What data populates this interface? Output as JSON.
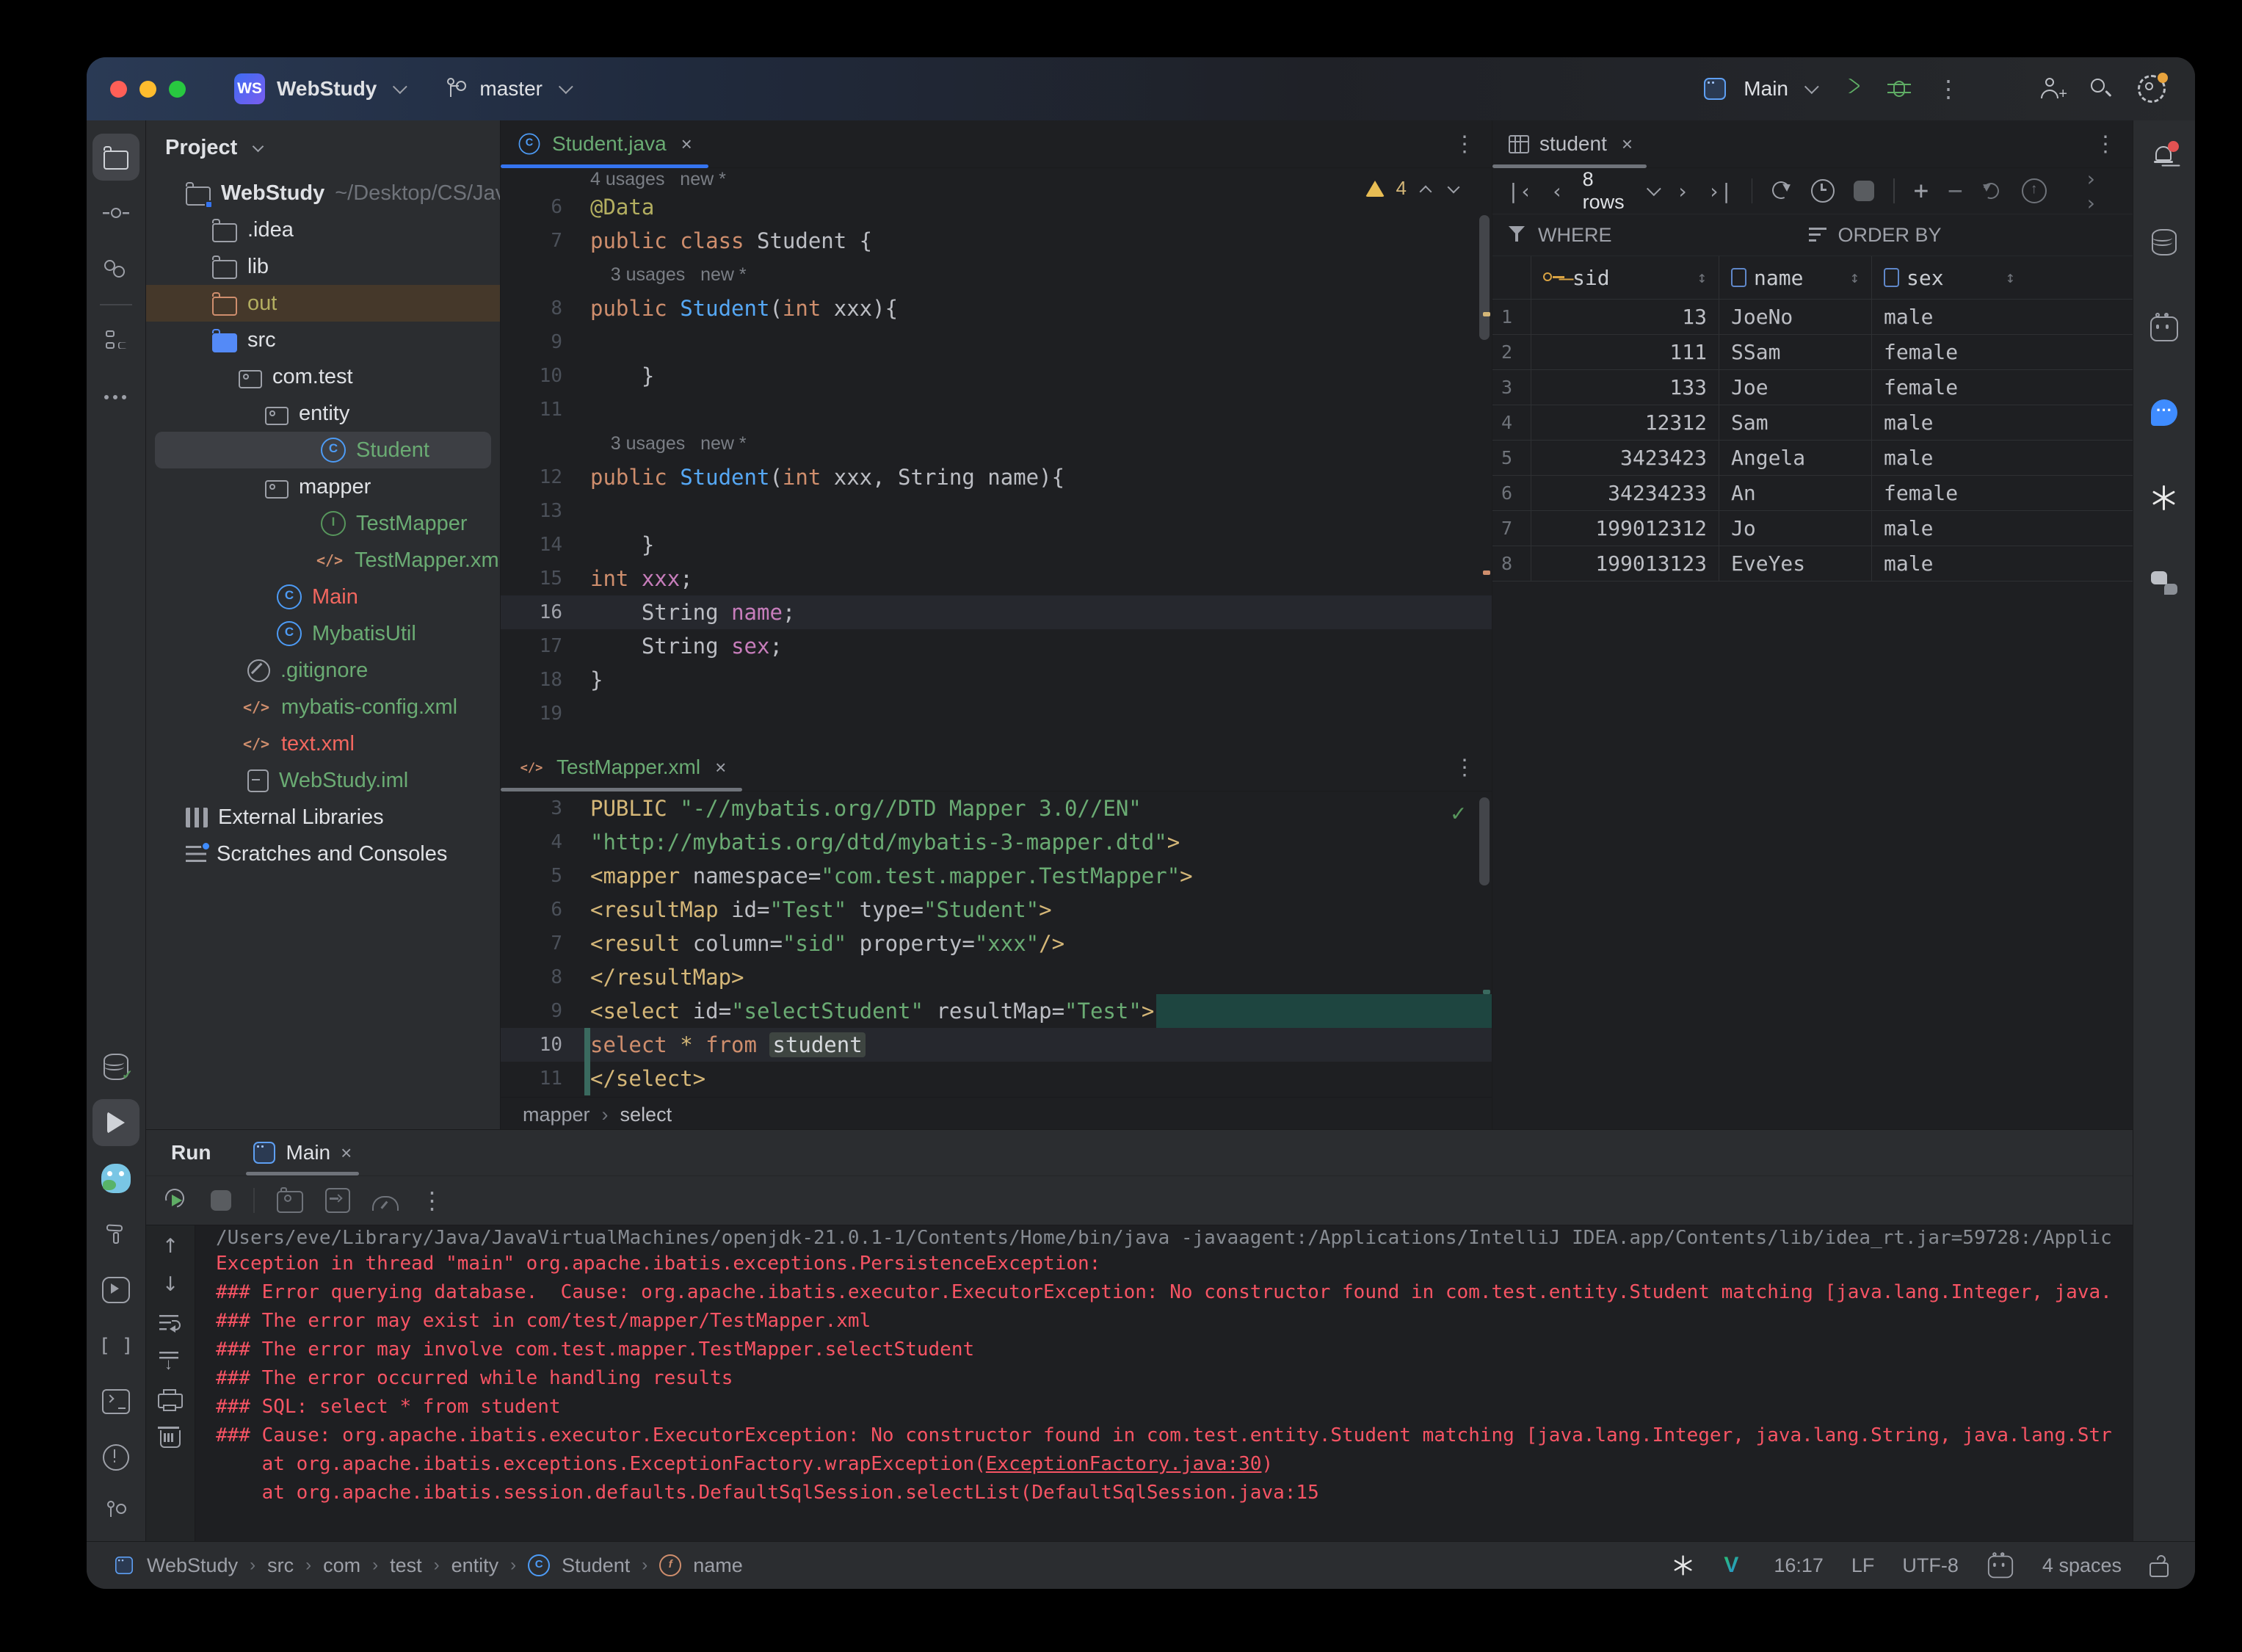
{
  "titlebar": {
    "project_badge": "WS",
    "project": "WebStudy",
    "branch": "master",
    "run_config": "Main",
    "icons": [
      "git-branch",
      "run",
      "debug",
      "more",
      "add-user",
      "search",
      "settings"
    ]
  },
  "left_strip_icons": [
    "project-folder",
    "commit",
    "pull-requests",
    "structure",
    "more",
    "database-check",
    "run",
    "go-plugin",
    "build",
    "coverage",
    "bookmarks",
    "terminal",
    "problems",
    "git"
  ],
  "right_strip_icons": [
    "notifications",
    "database",
    "ai-assistant",
    "chat",
    "openai",
    "collaboration"
  ],
  "project": {
    "header": "Project",
    "tree": [
      {
        "label": "WebStudy",
        "suffix": "~/Desktop/CS/Jav",
        "icon": "ic-folder-project",
        "chevcls": "chev-d",
        "cls": "t-bold",
        "style": "padding-left:24px"
      },
      {
        "label": ".idea",
        "icon": "ic-folder",
        "chevcls": "chev-r",
        "style": "padding-left:60px"
      },
      {
        "label": "lib",
        "icon": "ic-folder",
        "chevcls": "chev-r",
        "style": "padding-left:60px"
      },
      {
        "label": "out",
        "icon": "ic-folder-orange",
        "chevcls": "chev-r",
        "cls": "t-olive",
        "row": "row-out",
        "style": "padding-left:60px"
      },
      {
        "label": "src",
        "icon": "ic-folder-blue",
        "chevcls": "chev-d",
        "style": "padding-left:60px"
      },
      {
        "label": "com.test",
        "icon": "ic-pkg",
        "chevcls": "chev-d",
        "style": "padding-left:96px"
      },
      {
        "label": "entity",
        "icon": "ic-pkg",
        "chevcls": "chev-d",
        "style": "padding-left:132px"
      },
      {
        "label": "Student",
        "icon": "ic-class",
        "cls": "t-green",
        "row": "row-sel",
        "style": "padding-left:196px"
      },
      {
        "label": "mapper",
        "icon": "ic-pkg",
        "chevcls": "chev-d",
        "style": "padding-left:132px"
      },
      {
        "label": "TestMapper",
        "icon": "ic-iface",
        "cls": "t-green",
        "style": "padding-left:208px"
      },
      {
        "label": "TestMapper.xml",
        "icon": "ic-xmlfile",
        "cls": "t-green",
        "style": "padding-left:200px"
      },
      {
        "label": "Main",
        "icon": "ic-class",
        "cls": "t-red",
        "style": "padding-left:148px"
      },
      {
        "label": "MybatisUtil",
        "icon": "ic-class",
        "cls": "t-green",
        "style": "padding-left:148px"
      },
      {
        "label": ".gitignore",
        "icon": "ic-ign",
        "cls": "t-green",
        "style": "padding-left:108px"
      },
      {
        "label": "mybatis-config.xml",
        "icon": "ic-xmlfile",
        "cls": "t-green",
        "style": "padding-left:100px"
      },
      {
        "label": "text.xml",
        "icon": "ic-xmlfile",
        "cls": "t-red",
        "style": "padding-left:100px"
      },
      {
        "label": "WebStudy.iml",
        "icon": "ic-iml",
        "cls": "t-green",
        "style": "padding-left:108px"
      },
      {
        "label": "External Libraries",
        "icon": "ic-lib",
        "chevcls": "chev-r",
        "style": "padding-left:24px"
      },
      {
        "label": "Scratches and Consoles",
        "icon": "ic-scratch",
        "chevcls": "chev-r",
        "style": "padding-left:24px"
      }
    ]
  },
  "editors": {
    "java": {
      "tab": "Student.java",
      "warning_count": "4",
      "lines": [
        {
          "num": "",
          "seg": [
            [
              "g",
              "4 usages   new *"
            ]
          ],
          "style": "height:30px;overflow:hidden;align-items:flex-end"
        },
        {
          "num": "6",
          "seg": [
            [
              "a",
              "@Data"
            ]
          ]
        },
        {
          "num": "7",
          "seg": [
            [
              "k",
              "public class "
            ],
            [
              "p",
              "Student {"
            ]
          ]
        },
        {
          "num": "",
          "seg": [
            [
              "g",
              "    3 usages   new *"
            ]
          ]
        },
        {
          "num": "8",
          "seg": [
            [
              "p",
              "    "
            ],
            [
              "k",
              "public "
            ],
            [
              "c",
              "Student"
            ],
            [
              "p",
              "("
            ],
            [
              "k",
              "int"
            ],
            [
              "p",
              " xxx){"
            ]
          ]
        },
        {
          "num": "9",
          "seg": []
        },
        {
          "num": "10",
          "seg": [
            [
              "p",
              "    }"
            ]
          ]
        },
        {
          "num": "11",
          "seg": []
        },
        {
          "num": "",
          "seg": [
            [
              "g",
              "    3 usages   new *"
            ]
          ]
        },
        {
          "num": "12",
          "seg": [
            [
              "p",
              "    "
            ],
            [
              "k",
              "public "
            ],
            [
              "c",
              "Student"
            ],
            [
              "p",
              "("
            ],
            [
              "k",
              "int"
            ],
            [
              "p",
              " xxx, String name){"
            ]
          ]
        },
        {
          "num": "13",
          "seg": []
        },
        {
          "num": "14",
          "seg": [
            [
              "p",
              "    }"
            ]
          ]
        },
        {
          "num": "15",
          "seg": [
            [
              "p",
              "    "
            ],
            [
              "k",
              "int "
            ],
            [
              "f",
              "xxx"
            ],
            [
              "p",
              ";"
            ]
          ]
        },
        {
          "num": "16",
          "numcls": "on",
          "row": "cur",
          "seg": [
            [
              "p",
              "    String "
            ],
            [
              "f",
              "name"
            ],
            [
              "p",
              ";"
            ]
          ]
        },
        {
          "num": "17",
          "seg": [
            [
              "p",
              "    String "
            ],
            [
              "f",
              "sex"
            ],
            [
              "p",
              ";"
            ]
          ]
        },
        {
          "num": "18",
          "seg": [
            [
              "p",
              "}"
            ]
          ]
        },
        {
          "num": "19",
          "seg": []
        }
      ]
    },
    "xml": {
      "tab": "TestMapper.xml",
      "lines": [
        {
          "num": "3",
          "seg": [
            [
              "p",
              "        "
            ],
            [
              "y",
              "PUBLIC "
            ],
            [
              "s",
              "\"-//mybatis.org//DTD Mapper 3.0//EN\""
            ]
          ]
        },
        {
          "num": "4",
          "seg": [
            [
              "p",
              "        "
            ],
            [
              "s",
              "\"http://mybatis.org/dtd/mybatis-3-mapper.dtd\""
            ],
            [
              "y",
              ">"
            ]
          ]
        },
        {
          "num": "5",
          "seg": [
            [
              "y",
              "<mapper "
            ],
            [
              "p",
              "namespace="
            ],
            [
              "s",
              "\"com.test.mapper.TestMapper\""
            ],
            [
              "y",
              ">"
            ]
          ]
        },
        {
          "num": "6",
          "seg": [
            [
              "p",
              "    "
            ],
            [
              "y",
              "<resultMap "
            ],
            [
              "p",
              "id="
            ],
            [
              "s",
              "\"Test\""
            ],
            [
              "p",
              " type="
            ],
            [
              "s",
              "\"Student\""
            ],
            [
              "y",
              ">"
            ]
          ]
        },
        {
          "num": "7",
          "seg": [
            [
              "p",
              "        "
            ],
            [
              "y",
              "<result "
            ],
            [
              "p",
              "column="
            ],
            [
              "s",
              "\"sid\""
            ],
            [
              "p",
              " property="
            ],
            [
              "s",
              "\"xxx\""
            ],
            [
              "y",
              "/>"
            ]
          ]
        },
        {
          "num": "8",
          "seg": [
            [
              "p",
              "    "
            ],
            [
              "y",
              "</resultMap>"
            ]
          ]
        },
        {
          "num": "9",
          "seg": [
            [
              "p",
              "    "
            ],
            [
              "y",
              "<select "
            ],
            [
              "p",
              "id="
            ],
            [
              "s",
              "\"selectStudent\""
            ],
            [
              "p",
              " resultMap="
            ],
            [
              "s",
              "\"Test\""
            ],
            [
              "y",
              ">"
            ],
            [
              "fill",
              ""
            ]
          ]
        },
        {
          "num": "10",
          "numcls": "on",
          "row": "cur",
          "gut": "inj",
          "seg": [
            [
              "p",
              "        "
            ],
            [
              "k",
              "select "
            ],
            [
              "y",
              "* "
            ],
            [
              "k",
              "from "
            ],
            [
              "hl",
              "student"
            ]
          ]
        },
        {
          "num": "11",
          "gut": "inj",
          "seg": [
            [
              "p",
              "    "
            ],
            [
              "y",
              "</select>"
            ]
          ]
        }
      ]
    },
    "breadcrumb": [
      "mapper",
      "select"
    ]
  },
  "db": {
    "tab": "student",
    "rows_label": "8 rows",
    "where_label": "WHERE",
    "order_label": "ORDER BY",
    "cols": [
      {
        "label": "sid",
        "icon": "key"
      },
      {
        "label": "name",
        "icon": "column"
      },
      {
        "label": "sex",
        "icon": "column"
      }
    ],
    "rows": [
      {
        "n": "1",
        "sid": "13",
        "name": "JoeNo",
        "sex": "male"
      },
      {
        "n": "2",
        "sid": "111",
        "name": "SSam",
        "sex": "female"
      },
      {
        "n": "3",
        "sid": "133",
        "name": "Joe",
        "sex": "female"
      },
      {
        "n": "4",
        "sid": "12312",
        "name": "Sam",
        "sex": "male"
      },
      {
        "n": "5",
        "sid": "3423423",
        "name": "Angela",
        "sex": "male"
      },
      {
        "n": "6",
        "sid": "34234233",
        "name": "An",
        "sex": "female"
      },
      {
        "n": "7",
        "sid": "199012312",
        "name": "Jo",
        "sex": "male"
      },
      {
        "n": "8",
        "sid": "199013123",
        "name": "EveYes",
        "sex": "male"
      }
    ]
  },
  "run": {
    "title": "Run",
    "tab": "Main",
    "console": [
      {
        "cls": "clip",
        "seg": [
          [
            "cg",
            "/Users/eve/Library/Java/JavaVirtualMachines/openjdk-21.0.1-1/Contents/Home/bin/java -javaagent:/Applications/IntelliJ IDEA.app/Contents/lib/idea_rt.jar=59728:/Applic"
          ]
        ]
      },
      {
        "seg": [
          [
            "r",
            "Exception in thread \"main\" org.apache.ibatis.exceptions.PersistenceException: "
          ]
        ]
      },
      {
        "seg": [
          [
            "r",
            "### Error querying database.  Cause: org.apache.ibatis.executor.ExecutorException: No constructor found in com.test.entity.Student matching [java.lang.Integer, java."
          ]
        ]
      },
      {
        "seg": [
          [
            "r",
            "### The error may exist in com/test/mapper/TestMapper.xml"
          ]
        ]
      },
      {
        "seg": [
          [
            "r",
            "### The error may involve com.test.mapper.TestMapper.selectStudent"
          ]
        ]
      },
      {
        "seg": [
          [
            "r",
            "### The error occurred while handling results"
          ]
        ]
      },
      {
        "seg": [
          [
            "r",
            "### SQL: select * from student"
          ]
        ]
      },
      {
        "seg": [
          [
            "r",
            "### Cause: org.apache.ibatis.executor.ExecutorException: No constructor found in com.test.entity.Student matching [java.lang.Integer, java.lang.String, java.lang.Str"
          ]
        ]
      },
      {
        "seg": [
          [
            "r",
            "    at org.apache.ibatis.exceptions.ExceptionFactory.wrapException("
          ],
          [
            "rl",
            "ExceptionFactory.java:30"
          ],
          [
            "r",
            ")"
          ]
        ]
      },
      {
        "seg": [
          [
            "r",
            "    at org.apache.ibatis.session.defaults.DefaultSqlSession.selectList(DefaultSqlSession.java:15"
          ]
        ]
      }
    ]
  },
  "statusbar": {
    "crumbs": [
      "WebStudy",
      "src",
      "com",
      "test",
      "entity",
      "Student",
      "name"
    ],
    "time": "16:17",
    "line_sep": "LF",
    "encoding": "UTF-8",
    "indent": "4 spaces"
  }
}
